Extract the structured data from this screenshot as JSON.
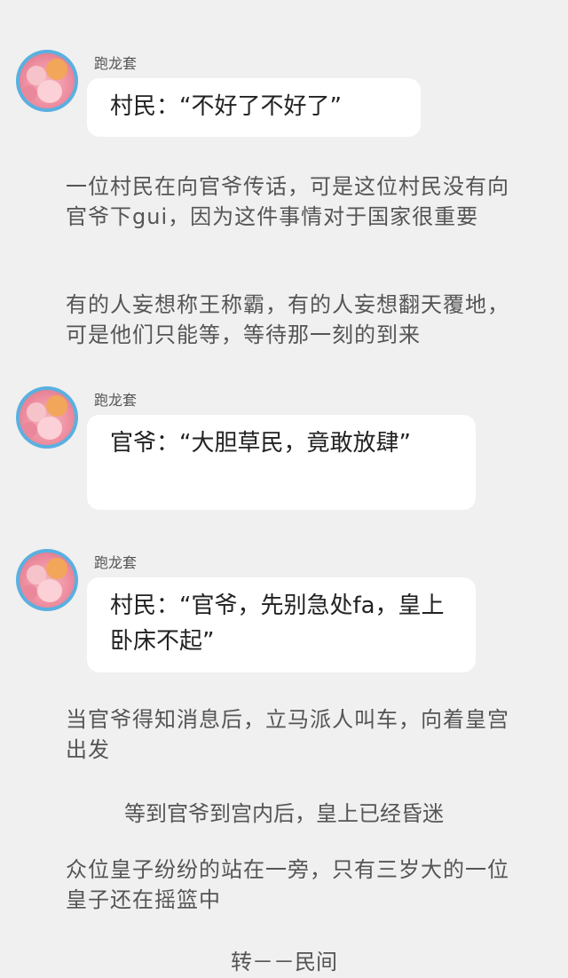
{
  "messages": [
    {
      "nickname": "跑龙套",
      "text": "村民：“不好了不好了”"
    },
    {
      "nickname": "跑龙套",
      "text": "官爷：“大胆草民，竟敢放肆”"
    },
    {
      "nickname": "跑龙套",
      "text": "村民：“官爷，先别急处fa，皇上卧床不起”"
    }
  ],
  "narration": [
    "一位村民在向官爷传话，可是这位村民没有向官爷下gui，因为这件事情对于国家很重要",
    "有的人妄想称王称霸，有的人妄想翻天覆地，可是他们只能等，等待那一刻的到来",
    "当官爷得知消息后，立马派人叫车，向着皇宫出发",
    "等到官爷到宫内后，皇上已经昏迷",
    "众位皇子纷纷的站在一旁，只有三岁大的一位皇子还在摇篮中"
  ],
  "footer": "转－－民间",
  "colors": {
    "background": "#f0f0f0",
    "bubble": "#ffffff",
    "avatar_ring": "#5ab0e0"
  }
}
